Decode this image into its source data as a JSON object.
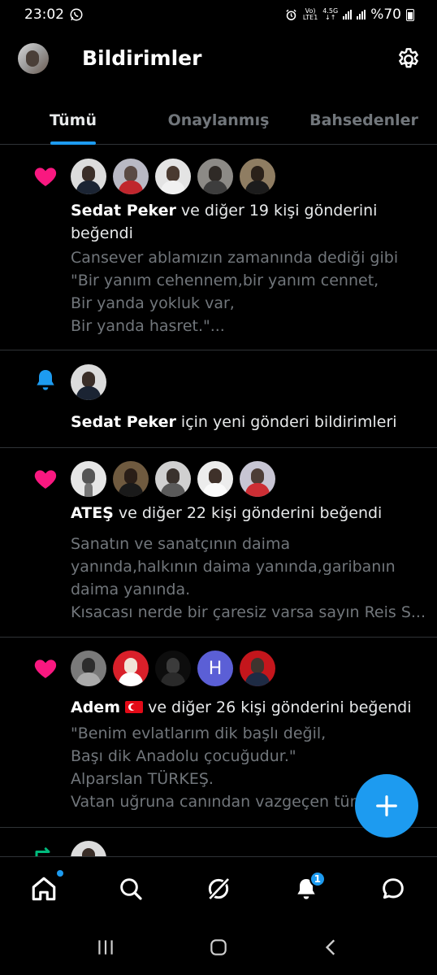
{
  "status": {
    "time": "23:02",
    "network_top": "Vo)",
    "network_bottom": "LTE1",
    "gen": "4.5G",
    "battery": "%70"
  },
  "header": {
    "title": "Bildirimler"
  },
  "tabs": [
    {
      "label": "Tümü",
      "active": true
    },
    {
      "label": "Onaylanmış",
      "active": false
    },
    {
      "label": "Bahsedenler",
      "active": false
    }
  ],
  "notifications": [
    {
      "type": "like",
      "actor": "Sedat Peker",
      "action": " ve diğer 19 kişi gönderini beğendi",
      "preview": "Cansever ablamızın zamanında dediği gibi\n\"Bir yanım cehennem,bir yanım cennet,\nBir yanda yokluk var,\nBir yanda hasret.\"..."
    },
    {
      "type": "bell",
      "actor": "Sedat Peker",
      "action": " için yeni gönderi bildirimleri"
    },
    {
      "type": "like",
      "actor": "ATEŞ",
      "action": " ve diğer 22 kişi gönderini beğendi",
      "preview": "Sanatın ve sanatçının daima\nyanında,halkının daima yanında,garibanın\ndaima yanında.\nKısacası nerde bir çaresiz varsa sayın Reis S..."
    },
    {
      "type": "like",
      "actor": "Adem",
      "avatar_letter": "H",
      "action": " ve diğer 26 kişi gönderini beğendi",
      "preview": "\"Benim evlatlarım dik başlı değil,\nBaşı dik Anadolu çocuğudur.\"\nAlparslan TÜRKEŞ.\nVatan uğruna canından vazgeçen tüm"
    }
  ],
  "bottom_nav": {
    "notifications_badge": "1"
  },
  "colors": {
    "accent": "#1d9bf0",
    "like": "#f91880",
    "retweet": "#00ba7c",
    "muted": "#71767b"
  }
}
